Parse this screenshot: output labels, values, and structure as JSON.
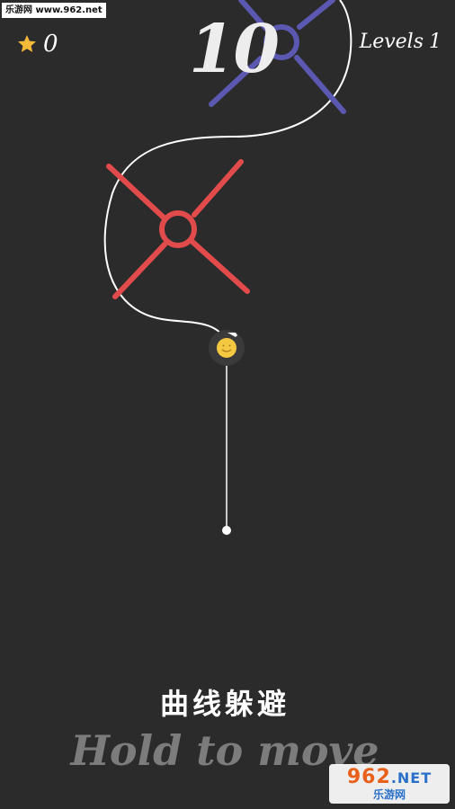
{
  "watermark": {
    "top_text": "乐游网 www.962.net",
    "logo_main": "962",
    "logo_net": ".NET",
    "logo_sub": "乐游网"
  },
  "hud": {
    "star_icon": "star-icon",
    "score": "0",
    "level_label": "Levels",
    "level_number": "1",
    "countdown": "10"
  },
  "game": {
    "obstacles": [
      {
        "name": "blue-cross-spinner",
        "color": "#5a58b0"
      },
      {
        "name": "red-cross-spinner",
        "color": "#e24b4b"
      }
    ],
    "player": {
      "name": "smiley-ball",
      "color": "#f5c842"
    },
    "path_color": "#ffffff"
  },
  "title_cn": "曲线躲避",
  "hint": "Hold to move"
}
